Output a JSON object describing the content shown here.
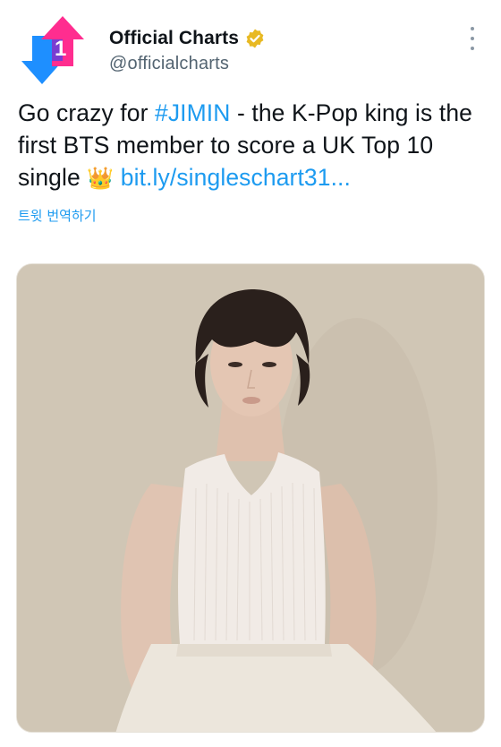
{
  "tweet": {
    "author": {
      "display_name": "Official Charts",
      "handle": "@officialcharts",
      "verified_badge_color": "#e8b923",
      "avatar_icon": "official-charts-logo-icon",
      "avatar_colors": {
        "pink": "#ff2d8f",
        "blue": "#1e8fff",
        "purple": "#6a3fd8"
      }
    },
    "menu_icon": "more-vertical-icon",
    "text": {
      "prefix": "Go crazy for ",
      "hashtag": "#JIMIN",
      "middle": " - the K-Pop king is the first BTS member to score a UK Top 10 single ",
      "emoji": "👑",
      "link": "bit.ly/singleschart31..."
    },
    "translate_label": "트윗 번역하기",
    "media": {
      "type": "photo",
      "background_color": "#d0c6b5"
    }
  },
  "colors": {
    "text": "#0f1419",
    "secondary": "#536471",
    "link": "#1d9bf0"
  }
}
